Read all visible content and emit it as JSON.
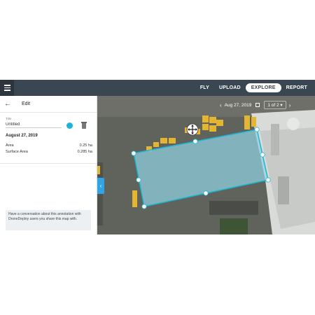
{
  "topbar": {
    "menu_icon": "hamburger-icon",
    "nav": [
      {
        "label": "FLY",
        "active": false
      },
      {
        "label": "UPLOAD",
        "active": false
      },
      {
        "label": "EXPLORE",
        "active": true
      },
      {
        "label": "REPORT",
        "active": false
      }
    ]
  },
  "panel": {
    "back_icon": "back-arrow-icon",
    "heading": "Edit",
    "title_label": "Title",
    "title_value": "Untitled",
    "color": "#19b5d4",
    "trash_icon": "trash-icon",
    "date": "August 27, 2019",
    "metrics": [
      {
        "label": "Area",
        "value": "0.25 ha"
      },
      {
        "label": "Surface Area",
        "value": "0.285 ha"
      }
    ],
    "conversation_text": "Have a conversation about this annotation with DroneDeploy users you share this map with."
  },
  "map": {
    "date": "Aug 27, 2019",
    "page": "1 of 2",
    "prev_icon": "chevron-left-icon",
    "next_icon": "chevron-right-icon",
    "calendar_icon": "calendar-icon",
    "collapse_icon": "chevron-left-icon",
    "move_icon": "move-icon",
    "annotation_color": "#19b5d4"
  }
}
